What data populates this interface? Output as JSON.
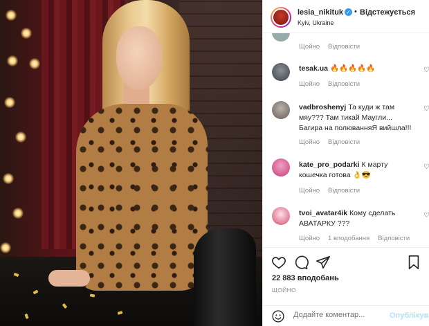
{
  "post": {
    "username": "lesia_nikituk",
    "follow_label": "Відстежується",
    "location": "Kyiv, Ukraine",
    "verified_icon": "verified-badge-icon"
  },
  "comments": [
    {
      "user": "",
      "text": "",
      "reply_label": "Відповісти",
      "likes_label": "",
      "ago": "Щойно"
    },
    {
      "user": "tesak.ua",
      "text": "🔥🔥🔥🔥🔥",
      "ago": "Щойно",
      "reply_label": "Відповісти"
    },
    {
      "user": "vadbroshenyj",
      "text": "Та куди ж там мяу??? Там тикай Маугли... Багира на полюванняЯ вийшла!!!",
      "ago": "Щойно",
      "reply_label": "Відповісти"
    },
    {
      "user": "kate_pro_podarki",
      "text": "К марту кошечка готова 👌😎",
      "ago": "Щойно",
      "reply_label": "Відповісти"
    },
    {
      "user": "tvoi_avatar4ik",
      "text": "Кому сделать АВАТАРКУ ???",
      "ago": "Щойно",
      "reply_label": "Відповісти",
      "replies": "1 вподобання"
    }
  ],
  "stats": {
    "likes": "22 883 вподобань",
    "ago": "ЩОЙНО"
  },
  "composer": {
    "placeholder": "Додайте коментар...",
    "publish_label": "Опублікувати"
  },
  "colors": {
    "accent": "#3897f0",
    "publish_disabled": "#b2dffc"
  }
}
